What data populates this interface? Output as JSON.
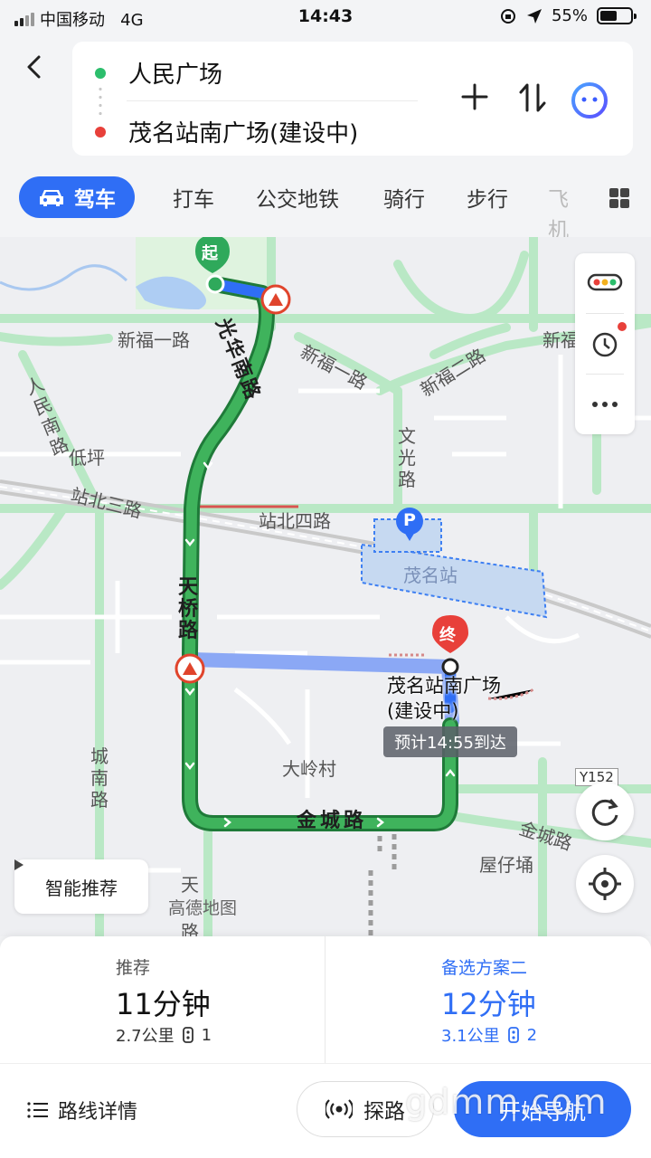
{
  "status_bar": {
    "carrier": "中国移动",
    "network": "4G",
    "time": "14:43",
    "battery_percent": "55%",
    "battery_level": 0.55
  },
  "route": {
    "from": "人民广场",
    "to": "茂名站南广场(建设中)"
  },
  "modes": {
    "drive": "驾车",
    "taxi": "打车",
    "transit": "公交地铁",
    "bike": "骑行",
    "walk": "步行",
    "fly": "飞机"
  },
  "map": {
    "start_marker": "起",
    "end_marker": "终",
    "parking_marker": "P",
    "labels": {
      "xinfu1": "新福一路",
      "xinfu1_b": "新福一路",
      "xinfu2": "新福二路",
      "xinfu_edge": "新福",
      "guanghua": "光华南路",
      "renmin_south": "人民南路",
      "diping": "低坪",
      "wenguang": "文光路",
      "zhanbei3": "站北三路",
      "zhanbei4": "站北四路",
      "maoming_station": "茂名站",
      "tianqiao": "天桥路",
      "chengnan": "城南路",
      "daling": "大岭村",
      "jincheng": "金城路",
      "jincheng_b": "金城路",
      "wuzaiyong": "屋仔埇",
      "road_code": "Y152",
      "tian": "天",
      "gaode_logo": "高德地图",
      "lu": "路"
    },
    "destination_name_line1": "茂名站南广场",
    "destination_name_line2": "(建设中)",
    "eta": "预计14:55到达",
    "smart_recommend": "智能推荐"
  },
  "plans": [
    {
      "label": "推荐",
      "duration": "11分钟",
      "distance": "2.7公里",
      "lights": "1"
    },
    {
      "label": "备选方案二",
      "duration": "12分钟",
      "distance": "3.1公里",
      "lights": "2"
    }
  ],
  "actions": {
    "route_detail": "路线详情",
    "explore": "探路",
    "start_nav": "开始导航"
  },
  "watermark": "gdmm.com",
  "colors": {
    "accent": "#2f6ef5",
    "route_green": "#3fb35c",
    "start_dot": "#2cbe6c",
    "end_dot": "#e8403a"
  }
}
